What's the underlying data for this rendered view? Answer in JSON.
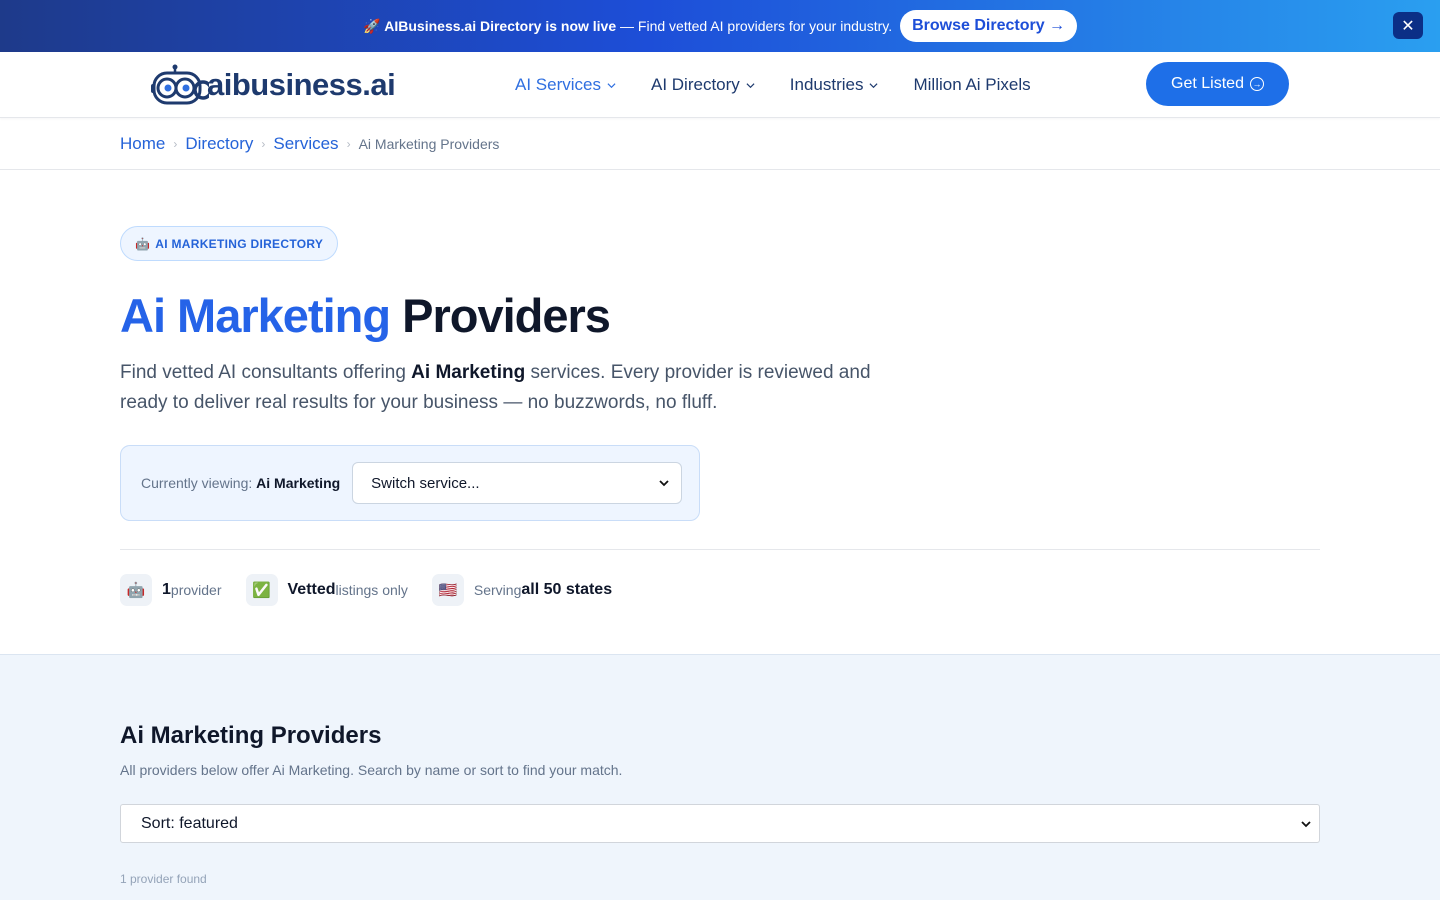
{
  "announcement": {
    "rocket": "🚀",
    "bold": "AIBusiness.ai Directory is now live",
    "rest": " — Find vetted AI providers for your industry.",
    "button": "Browse Directory →",
    "close": "✕"
  },
  "header": {
    "logo_text": "aibusiness.ai",
    "nav": [
      {
        "label": "AI Services"
      },
      {
        "label": "AI Directory"
      },
      {
        "label": "Industries"
      },
      {
        "label": "Million Ai Pixels"
      }
    ],
    "cta": "Get Listed",
    "cta_icon": "→"
  },
  "breadcrumb": {
    "items": [
      "Home",
      "Directory",
      "Services"
    ],
    "sep": "›",
    "current": "Ai Marketing Providers"
  },
  "hero": {
    "badge_emoji": "🤖",
    "badge": "AI MARKETING DIRECTORY",
    "title_accent": "Ai Marketing",
    "title_rest": " Providers",
    "desc_pre": "Find vetted AI consultants offering ",
    "desc_bold": "Ai Marketing",
    "desc_post": " services. Every provider is reviewed and ready to deliver real results for your business — no buzzwords, no fluff.",
    "viewing_label": "Currently viewing: ",
    "viewing_value": "Ai Marketing",
    "switch_placeholder": "Switch service..."
  },
  "stats": [
    {
      "icon": "🤖",
      "strong": "1",
      "light": " provider"
    },
    {
      "icon": "✅",
      "strong": "Vetted",
      "light": " listings only"
    },
    {
      "icon": "🇺🇸",
      "light": "Serving ",
      "strong": "all 50 states"
    }
  ],
  "providers": {
    "title": "Ai Marketing Providers",
    "subtitle": "All providers below offer Ai Marketing. Search by name or sort to find your match.",
    "sort": "Sort: featured",
    "found": "1 provider found"
  },
  "colors": {
    "brand_blue": "#1e6fe8",
    "accent_text": "#2563e8",
    "navy": "#1e3a6e"
  }
}
